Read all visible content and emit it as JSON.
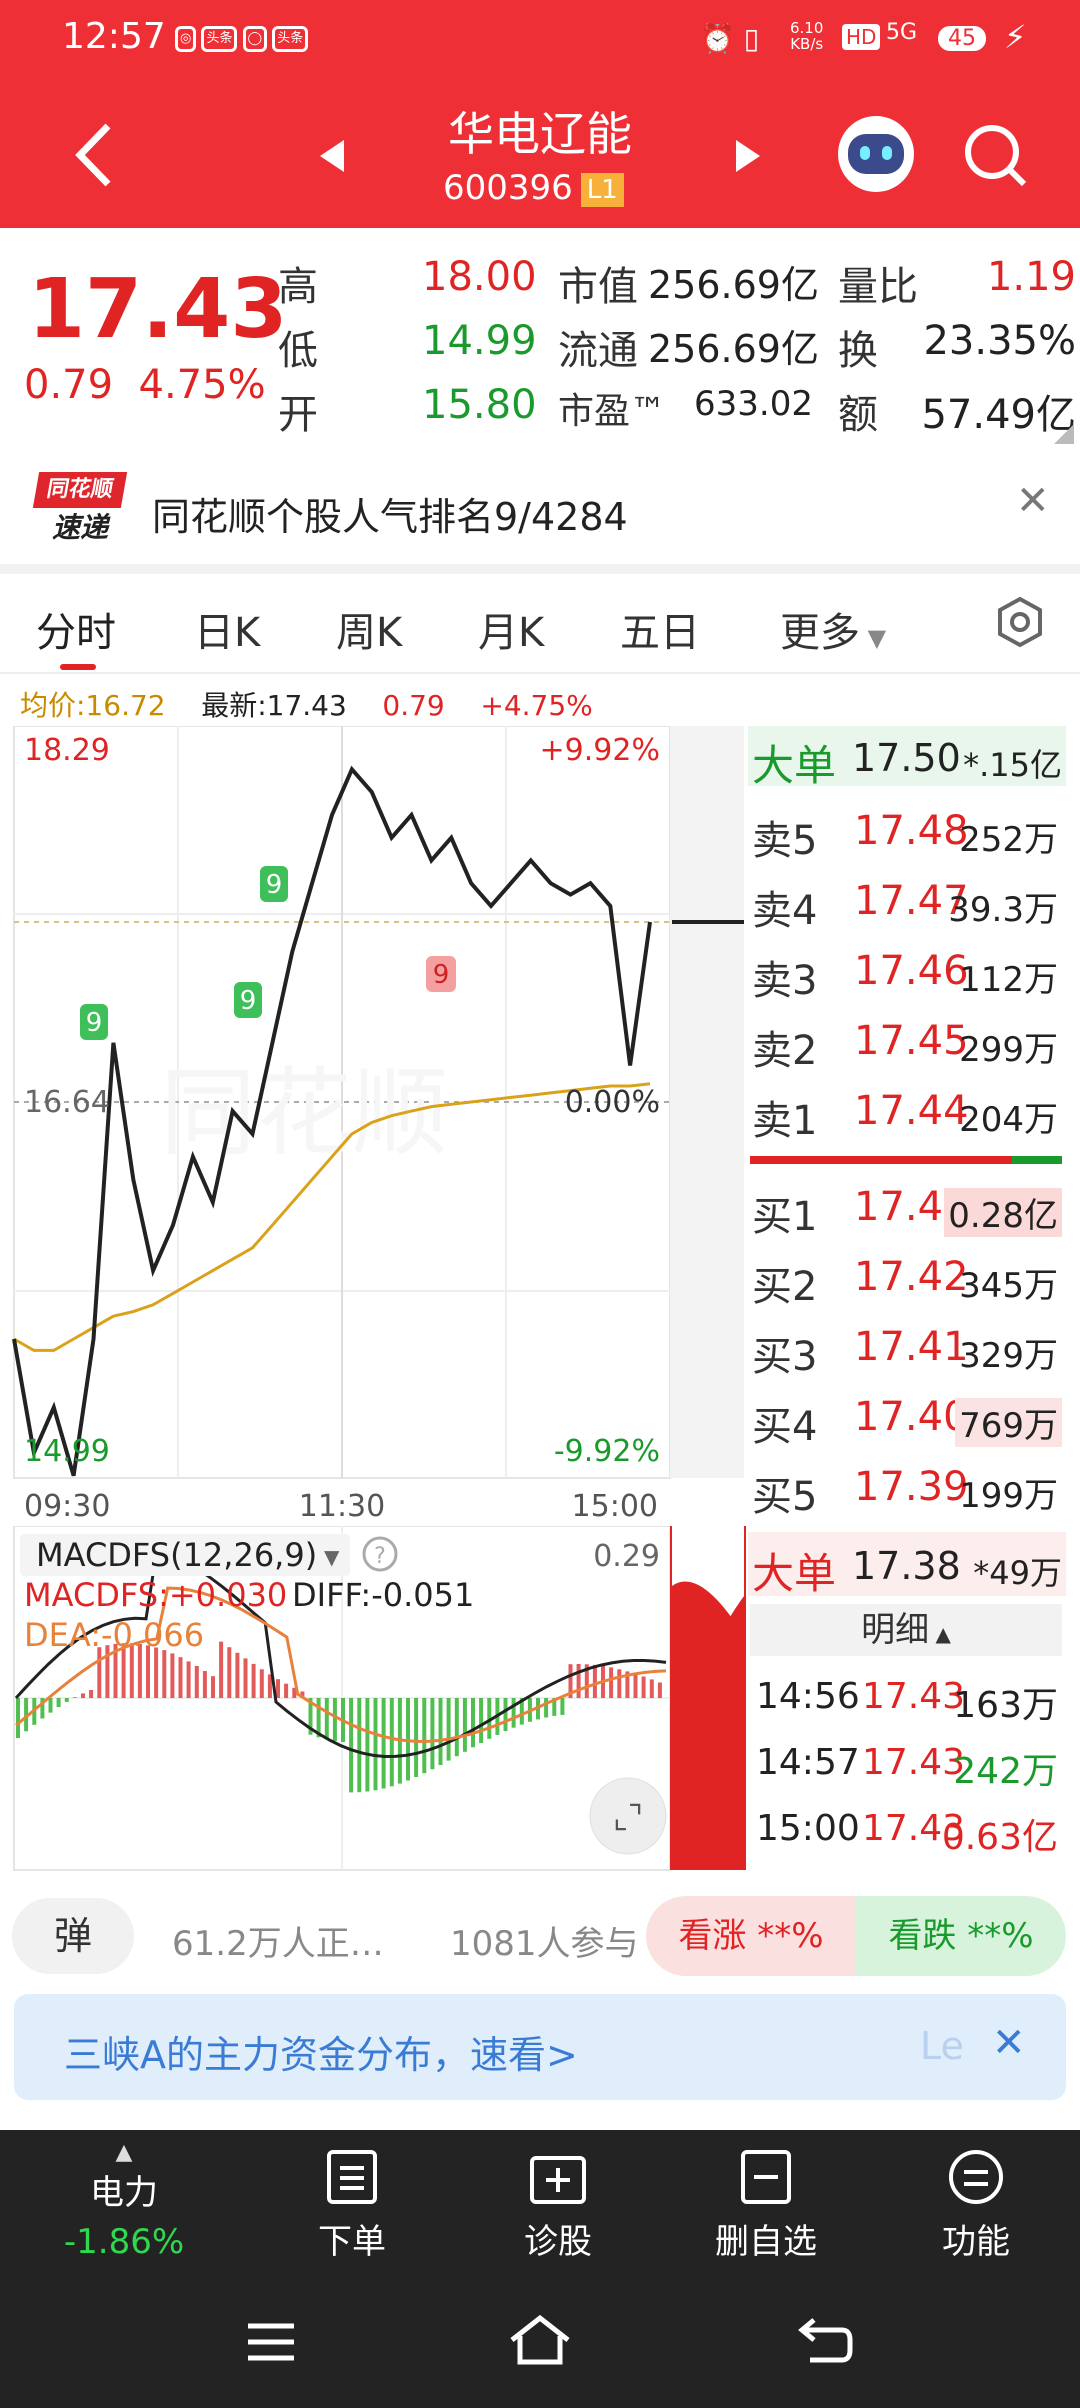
{
  "status_bar": {
    "time": "12:57",
    "net_speed_top": "6.10",
    "net_speed_unit": "KB/s",
    "hd": "HD",
    "signal": "5G",
    "battery": "45"
  },
  "header": {
    "title": "华电辽能",
    "code": "600396",
    "level": "L1"
  },
  "quote": {
    "price": "17.43",
    "change": "0.79",
    "change_pct": "4.75%",
    "high_label": "高",
    "high": "18.00",
    "low_label": "低",
    "low": "14.99",
    "open_label": "开",
    "open": "15.80",
    "mcap_label": "市值",
    "mcap": "256.69亿",
    "float_label": "流通",
    "float": "256.69亿",
    "pe_label": "市盈™",
    "pe": "633.02",
    "vr_label": "量比",
    "vr": "1.19",
    "turn_label": "换",
    "turn": "23.35%",
    "amt_label": "额",
    "amt": "57.49亿"
  },
  "notice": {
    "logo_top": "同花顺",
    "logo_bottom": "速递",
    "text": "同花顺个股人气排名9/4284"
  },
  "tabs": [
    "分时",
    "日K",
    "周K",
    "月K",
    "五日",
    "更多"
  ],
  "info_line": {
    "avg": "均价:16.72",
    "latest": "最新:17.43",
    "chg": "0.79",
    "pct": "+4.75%"
  },
  "chart_labels": {
    "top_price": "18.29",
    "top_pct": "+9.92%",
    "mid_price": "16.64",
    "mid_pct": "0.00%",
    "bot_price": "14.99",
    "bot_pct": "-9.92%",
    "t1": "09:30",
    "t2": "11:30",
    "t3": "15:00",
    "watermark": "同花顺"
  },
  "markers": [
    "9",
    "9",
    "9",
    "9"
  ],
  "chart_data": {
    "type": "line",
    "title": "",
    "x_labels": [
      "09:30",
      "11:30",
      "15:00"
    ],
    "ylim": [
      14.99,
      18.29
    ],
    "series": [
      {
        "name": "",
        "values": [
          15.6,
          15.1,
          15.3,
          15.0,
          15.6,
          16.9,
          16.3,
          15.9,
          16.1,
          16.4,
          16.2,
          16.6,
          16.5,
          16.9,
          17.3,
          17.6,
          17.9,
          18.1,
          18.0,
          17.8,
          17.9,
          17.7,
          17.8,
          17.6,
          17.5,
          17.6,
          17.7,
          17.6,
          17.55,
          17.6,
          17.5,
          16.8,
          17.43
        ]
      },
      {
        "name": "",
        "values": [
          15.6,
          15.55,
          15.55,
          15.6,
          15.65,
          15.7,
          15.72,
          15.75,
          15.8,
          15.85,
          15.9,
          15.95,
          16.0,
          16.1,
          16.2,
          16.3,
          16.4,
          16.5,
          16.55,
          16.58,
          16.6,
          16.62,
          16.63,
          16.64,
          16.65,
          16.66,
          16.67,
          16.68,
          16.69,
          16.7,
          16.71,
          16.71,
          16.72
        ]
      }
    ]
  },
  "order_book": {
    "big_top": {
      "label": "大单",
      "price": "17.50",
      "vol": "*.15亿"
    },
    "sells": [
      {
        "label": "卖5",
        "price": "17.48",
        "vol": "252万"
      },
      {
        "label": "卖4",
        "price": "17.47",
        "vol": "39.3万"
      },
      {
        "label": "卖3",
        "price": "17.46",
        "vol": "112万"
      },
      {
        "label": "卖2",
        "price": "17.45",
        "vol": "299万"
      },
      {
        "label": "卖1",
        "price": "17.44",
        "vol": "204万"
      }
    ],
    "buys": [
      {
        "label": "买1",
        "price": "17.43",
        "vol": "0.28亿"
      },
      {
        "label": "买2",
        "price": "17.42",
        "vol": "345万"
      },
      {
        "label": "买3",
        "price": "17.41",
        "vol": "329万"
      },
      {
        "label": "买4",
        "price": "17.40",
        "vol": "769万"
      },
      {
        "label": "买5",
        "price": "17.39",
        "vol": "199万"
      }
    ],
    "big_bottom": {
      "label": "大单",
      "price": "17.38",
      "vol": "*49万"
    },
    "detail_label": "明细",
    "ticks": [
      {
        "time": "14:56",
        "price": "17.43",
        "vol": "163万"
      },
      {
        "time": "14:57",
        "price": "17.43",
        "vol": "242万"
      },
      {
        "time": "15:00",
        "price": "17.43",
        "vol": "0.63亿"
      }
    ]
  },
  "macd": {
    "title": "MACDFS(12,26,9)",
    "value": "MACDFS:+0.030",
    "diff": "DIFF:-0.051",
    "dea": "DEA:-0.066",
    "max": "0.29"
  },
  "bottom_bar": {
    "barrage": "弹",
    "viewers": "61.2万人正…",
    "participants": "1081人参与",
    "up": "看涨 **%",
    "down": "看跌 **%"
  },
  "banner": {
    "text": "三峡A的主力资金分布，速看>",
    "tail": "Le"
  },
  "footer": {
    "sector": "电力",
    "sector_pct": "-1.86%",
    "items": [
      "下单",
      "诊股",
      "删自选",
      "功能"
    ]
  }
}
